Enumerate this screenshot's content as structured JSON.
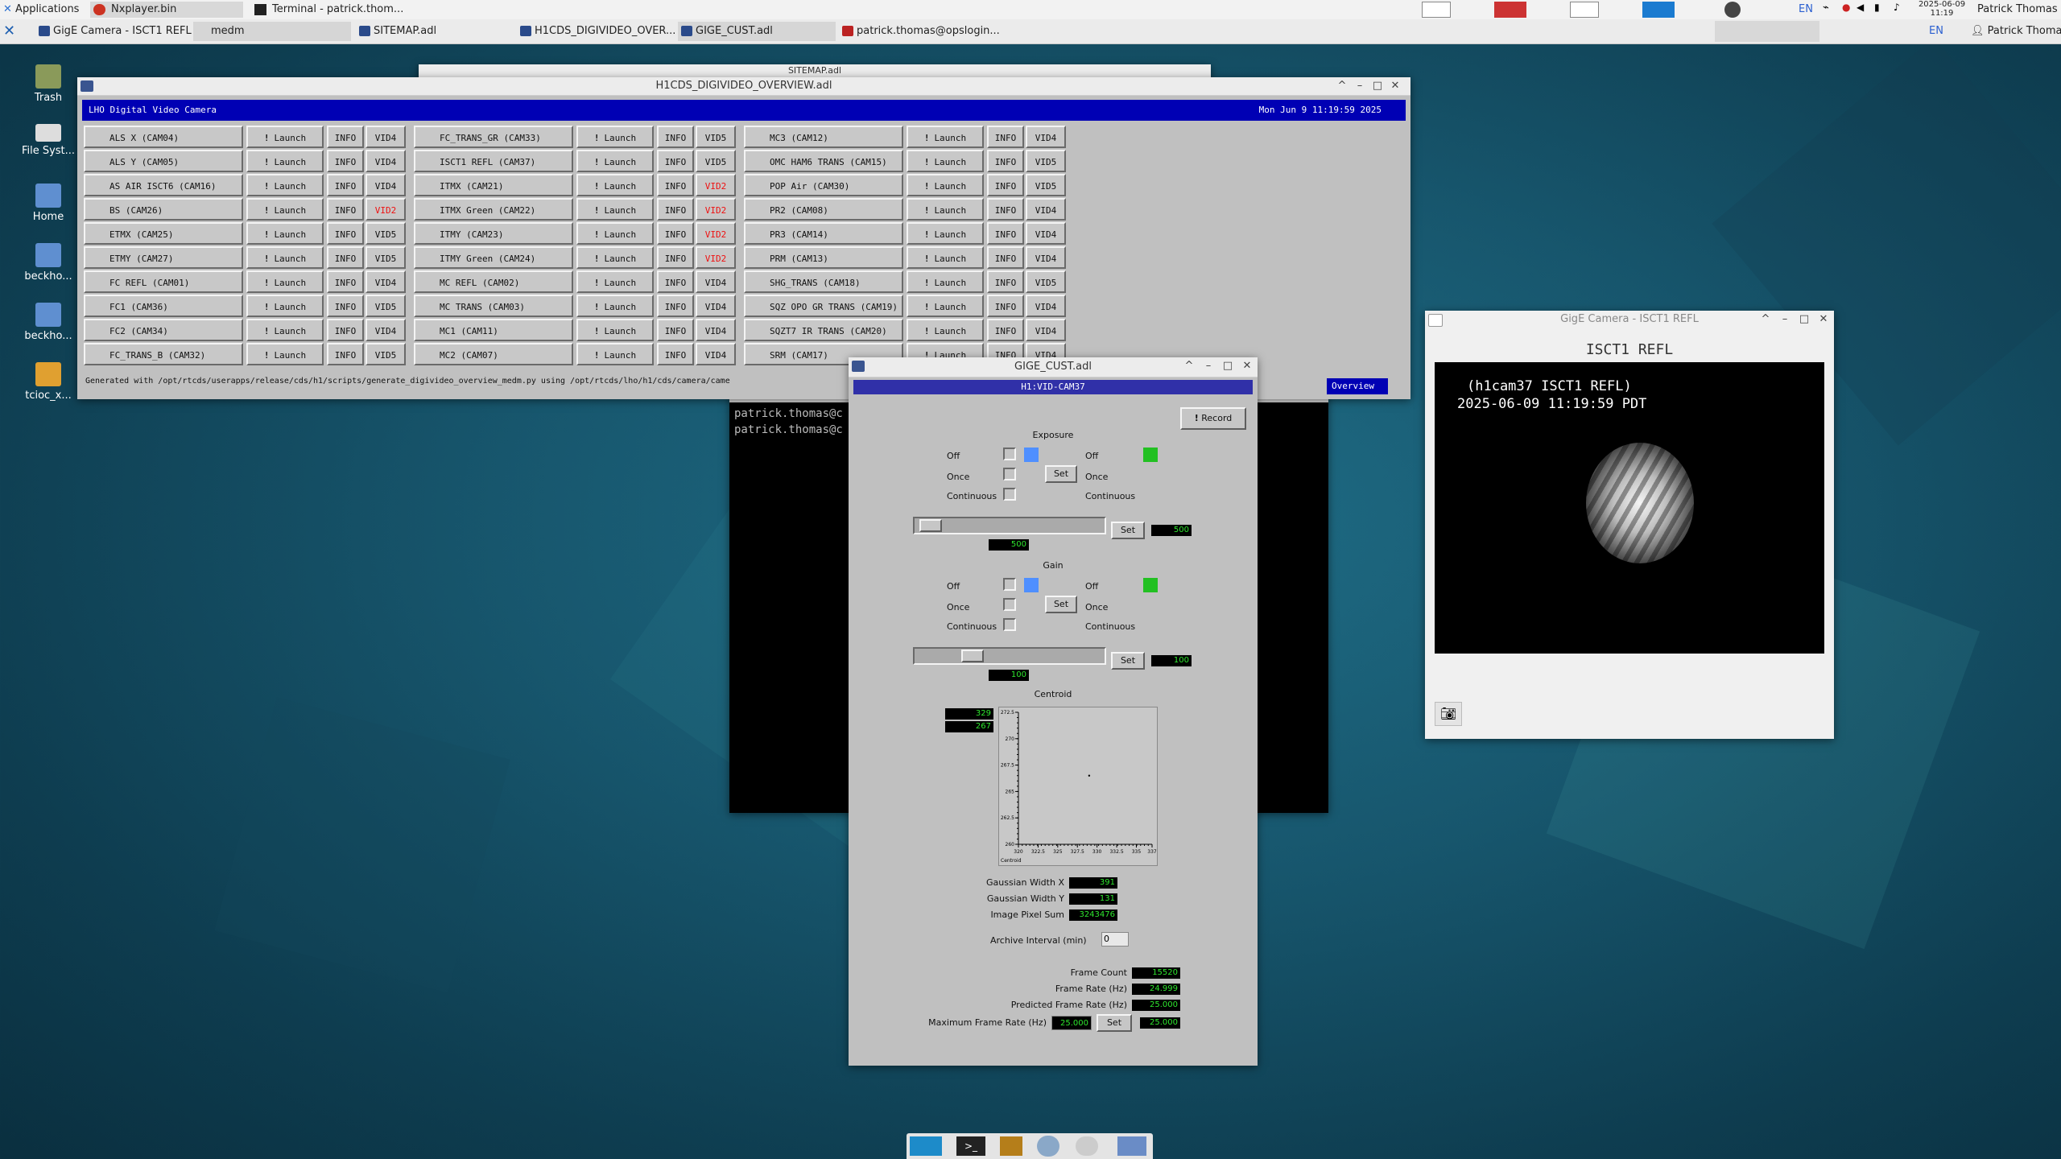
{
  "top_panel": {
    "applications": "Applications",
    "apps": [
      "Nxplayer.bin",
      "Terminal - patrick.thom..."
    ],
    "lang": "EN",
    "date": "2025-06-09",
    "time": "11:19",
    "user": "Patrick Thomas"
  },
  "taskbar": {
    "tasks": [
      "GigE Camera - ISCT1 REFL",
      "medm",
      "SITEMAP.adl",
      "H1CDS_DIGIVIDEO_OVER...",
      "GIGE_CUST.adl",
      "patrick.thomas@opslogin..."
    ],
    "lang": "EN",
    "user": "Patrick Thomas"
  },
  "desktop_icons": [
    "Trash",
    "File Syst...",
    "Home",
    "beckho...",
    "beckho...",
    "tcioc_x..."
  ],
  "sitemap_window": {
    "title": "SITEMAP.adl"
  },
  "overview": {
    "window_title": "H1CDS_DIGIVIDEO_OVERVIEW.adl",
    "banner_title": "LHO Digital Video Camera",
    "banner_date": "Mon Jun  9 11:19:59 2025",
    "launch_label": "Launch",
    "info_label": "INFO",
    "columns": [
      [
        {
          "name": "ALS X (CAM04)",
          "vid": "VID4"
        },
        {
          "name": "ALS Y (CAM05)",
          "vid": "VID4"
        },
        {
          "name": "AS AIR ISCT6 (CAM16)",
          "vid": "VID4"
        },
        {
          "name": "BS (CAM26)",
          "vid": "VID2",
          "alarm": true
        },
        {
          "name": "ETMX (CAM25)",
          "vid": "VID5"
        },
        {
          "name": "ETMY (CAM27)",
          "vid": "VID5"
        },
        {
          "name": "FC REFL (CAM01)",
          "vid": "VID4"
        },
        {
          "name": "FC1 (CAM36)",
          "vid": "VID5"
        },
        {
          "name": "FC2 (CAM34)",
          "vid": "VID4"
        },
        {
          "name": "FC_TRANS_B (CAM32)",
          "vid": "VID5"
        }
      ],
      [
        {
          "name": "FC_TRANS_GR (CAM33)",
          "vid": "VID5"
        },
        {
          "name": "ISCT1 REFL (CAM37)",
          "vid": "VID5"
        },
        {
          "name": "ITMX (CAM21)",
          "vid": "VID2",
          "alarm": true
        },
        {
          "name": "ITMX Green (CAM22)",
          "vid": "VID2",
          "alarm": true
        },
        {
          "name": "ITMY (CAM23)",
          "vid": "VID2",
          "alarm": true
        },
        {
          "name": "ITMY Green (CAM24)",
          "vid": "VID2",
          "alarm": true
        },
        {
          "name": "MC REFL (CAM02)",
          "vid": "VID4"
        },
        {
          "name": "MC TRANS (CAM03)",
          "vid": "VID4"
        },
        {
          "name": "MC1 (CAM11)",
          "vid": "VID4"
        },
        {
          "name": "MC2 (CAM07)",
          "vid": "VID4"
        }
      ],
      [
        {
          "name": "MC3 (CAM12)",
          "vid": "VID4"
        },
        {
          "name": "OMC HAM6 TRANS (CAM15)",
          "vid": "VID5"
        },
        {
          "name": "POP Air (CAM30)",
          "vid": "VID5"
        },
        {
          "name": "PR2 (CAM08)",
          "vid": "VID4"
        },
        {
          "name": "PR3 (CAM14)",
          "vid": "VID4"
        },
        {
          "name": "PRM (CAM13)",
          "vid": "VID4"
        },
        {
          "name": "SHG_TRANS (CAM18)",
          "vid": "VID5"
        },
        {
          "name": "SQZ OPO GR TRANS (CAM19)",
          "vid": "VID4"
        },
        {
          "name": "SQZT7 IR TRANS (CAM20)",
          "vid": "VID4"
        },
        {
          "name": "SRM (CAM17)",
          "vid": "VID4"
        }
      ]
    ],
    "footer": "Generated with /opt/rtcds/userapps/release/cds/h1/scripts/generate_digivideo_overview_medm.py using /opt/rtcds/lho/h1/cds/camera/came",
    "overview_button": "Overview"
  },
  "terminal": {
    "lines": [
      "patrick.thomas@c",
      "patrick.thomas@c"
    ]
  },
  "gige_cust": {
    "window_title": "GIGE_CUST.adl",
    "header": "H1:VID-CAM37",
    "record_label": "Record",
    "exposure": {
      "title": "Exposure",
      "modes": [
        "Off",
        "Once",
        "Continuous"
      ],
      "readback_modes": [
        "Off",
        "Once",
        "Continuous"
      ],
      "set_label": "Set",
      "slider_value": 500,
      "slider_fraction": 0.03,
      "readback": "500"
    },
    "gain": {
      "title": "Gain",
      "modes": [
        "Off",
        "Once",
        "Continuous"
      ],
      "readback_modes": [
        "Off",
        "Once",
        "Continuous"
      ],
      "set_label": "Set",
      "slider_value": 100,
      "slider_fraction": 0.28,
      "readback": "100"
    },
    "centroid": {
      "title": "Centroid",
      "x": "329",
      "y": "267",
      "y_ticks": [
        "272.5",
        "270",
        "267.5",
        "265",
        "262.5",
        "260"
      ],
      "x_ticks": [
        "320",
        "322.5",
        "325",
        "327.5",
        "330",
        "332.5",
        "335",
        "337"
      ],
      "axis_label": "Centroid",
      "point_x": 329,
      "point_y": 266.5
    },
    "fields": [
      {
        "label": "Gaussian Width X",
        "value": "391"
      },
      {
        "label": "Gaussian Width Y",
        "value": "131"
      },
      {
        "label": "Image Pixel Sum",
        "value": "3243476"
      }
    ],
    "archive_label": "Archive Interval (min)",
    "archive_value": "0",
    "frame_count_label": "Frame Count",
    "frame_count": "15520",
    "frame_rate_label": "Frame Rate (Hz)",
    "frame_rate": "24.999",
    "pred_frame_rate_label": "Predicted Frame Rate (Hz)",
    "pred_frame_rate": "25.000",
    "max_frame_rate_label": "Maximum Frame Rate (Hz)",
    "max_frame_rate": "25.000",
    "max_frame_rate_readback": "25.000",
    "set_label": "Set"
  },
  "camera_window": {
    "title": "GigE Camera - ISCT1 REFL",
    "name": "ISCT1 REFL",
    "overlay_line1": "(h1cam37 ISCT1 REFL)",
    "overlay_line2": "2025-06-09 11:19:59 PDT"
  },
  "dock": [
    "workspace-1",
    "terminal",
    "files",
    "web-browser",
    "search",
    "folder"
  ],
  "colors": {
    "medm_blue": "#0000b4",
    "medm_gray": "#c0c0c0",
    "readback_green": "#2ee62e",
    "alarm_red": "#e11111"
  }
}
